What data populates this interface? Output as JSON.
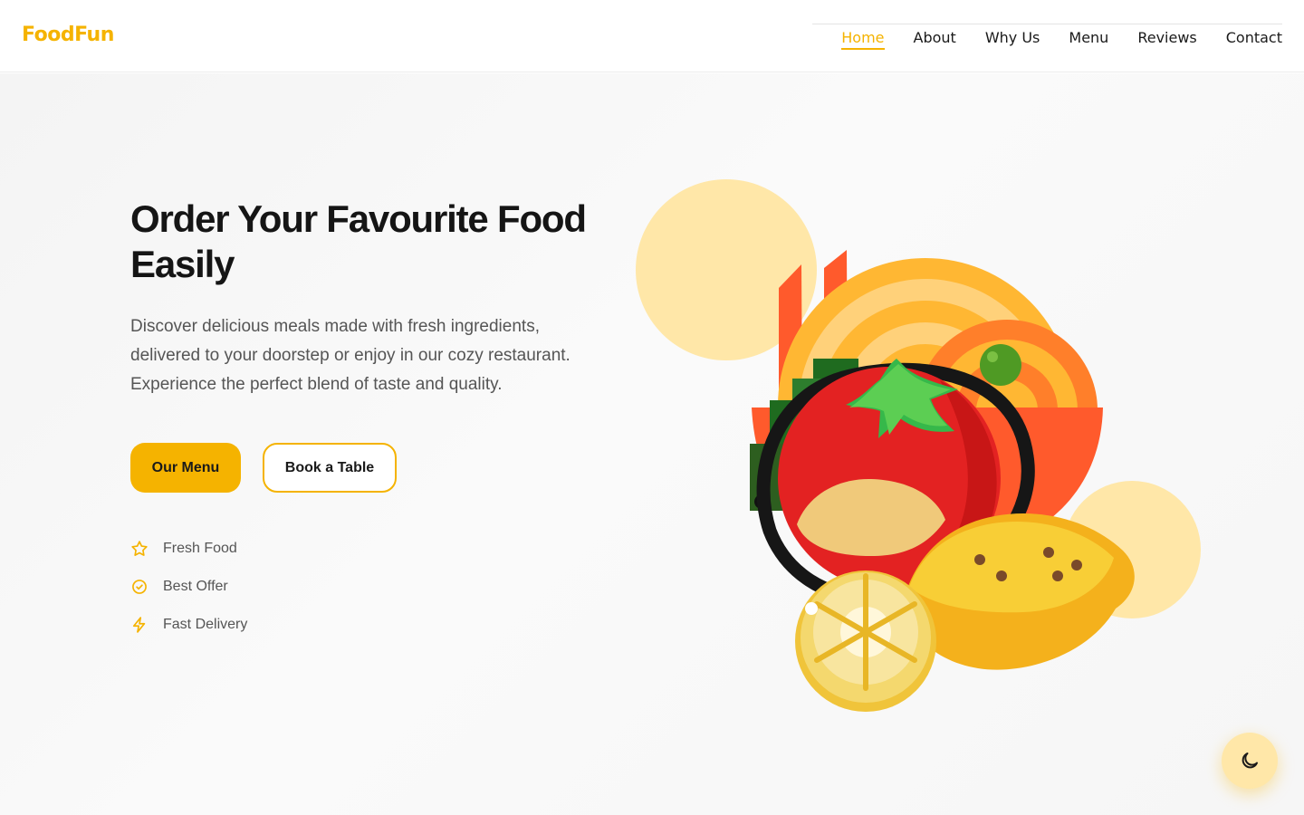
{
  "brand": {
    "name": "FoodFun",
    "accent_color": "#F5B300",
    "accent_light": "#FFE7A8"
  },
  "nav": {
    "links": [
      {
        "label": "Home",
        "active": true
      },
      {
        "label": "About",
        "active": false
      },
      {
        "label": "Why Us",
        "active": false
      },
      {
        "label": "Menu",
        "active": false
      },
      {
        "label": "Reviews",
        "active": false
      },
      {
        "label": "Contact",
        "active": false
      }
    ]
  },
  "hero": {
    "title": "Order Your Favourite Food Easily",
    "description": "Discover delicious meals made with fresh ingredients, delivered to your doorstep or enjoy in our cozy restaurant. Experience the perfect blend of taste and quality.",
    "primary_button": "Our Menu",
    "secondary_button": "Book a Table",
    "features": [
      {
        "icon": "star-icon",
        "label": "Fresh Food"
      },
      {
        "icon": "check-circle-icon",
        "label": "Best Offer"
      },
      {
        "icon": "lightning-icon",
        "label": "Fast Delivery"
      }
    ]
  },
  "theme_toggle": {
    "icon": "moon-icon"
  }
}
